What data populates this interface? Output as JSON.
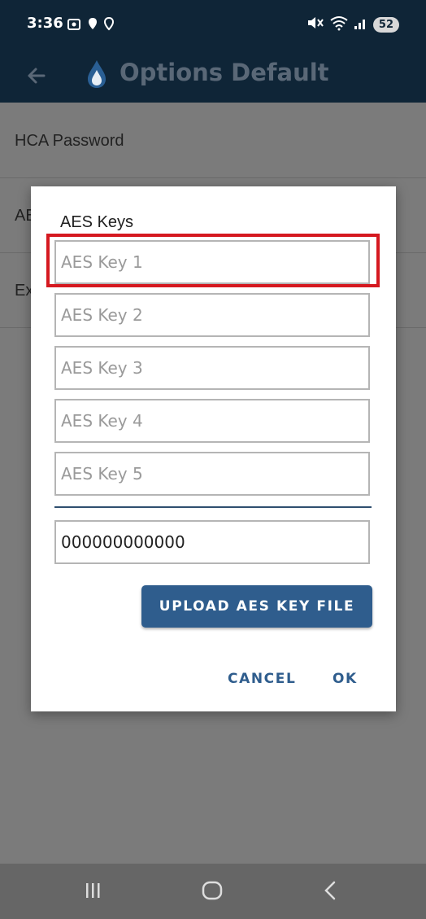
{
  "status_bar": {
    "time": "3:36",
    "battery": "52",
    "notification_icons": [
      "screenshot-icon",
      "location-icon",
      "location-icon"
    ],
    "system_icons": [
      "mute-icon",
      "wifi-icon",
      "signal-icon"
    ]
  },
  "app_bar": {
    "title": "Options Default",
    "back_icon": "arrow-left-icon",
    "logo_icon": "water-drop-icon"
  },
  "background_list": {
    "items": [
      {
        "label": "HCA Password"
      },
      {
        "label": "AE"
      },
      {
        "label": "Ex"
      }
    ]
  },
  "dialog": {
    "title": "AES Keys",
    "key_fields": [
      {
        "placeholder": "AES Key 1",
        "value": ""
      },
      {
        "placeholder": "AES Key 2",
        "value": ""
      },
      {
        "placeholder": "AES Key 3",
        "value": ""
      },
      {
        "placeholder": "AES Key 4",
        "value": ""
      },
      {
        "placeholder": "AES Key 5",
        "value": ""
      }
    ],
    "value_field": "000000000000",
    "upload_button": "UPLOAD AES KEY FILE",
    "cancel_button": "CANCEL",
    "ok_button": "OK",
    "highlight_color": "#d51920",
    "accent_color": "#2f5d8d"
  },
  "nav_bar": {
    "recents_icon": "recents-icon",
    "home_icon": "home-icon",
    "back_icon": "back-chevron-icon"
  }
}
